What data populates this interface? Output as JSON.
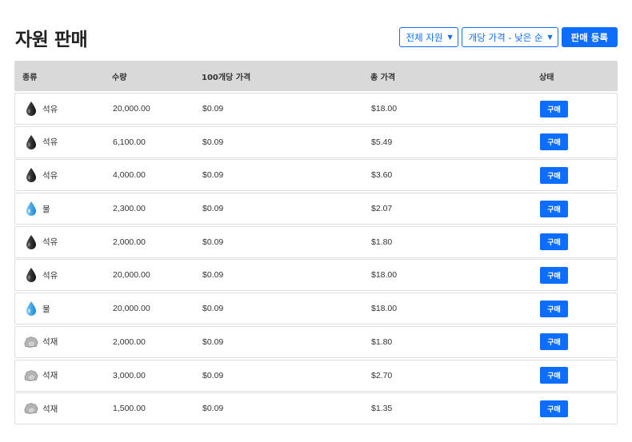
{
  "page": {
    "title": "자원 판매"
  },
  "toolbar": {
    "resource_filter": "전체 자원",
    "sort_filter": "개당 가격 - 낮은 순",
    "register_label": "판매 등록"
  },
  "table": {
    "headers": {
      "type": "종류",
      "quantity": "수량",
      "unit_price": "100개당 가격",
      "total_price": "총 가격",
      "status": "상태"
    },
    "rows": [
      {
        "icon": "oil-drop-icon",
        "name": "석유",
        "quantity": "20,000.00",
        "unit_price": "$0.09",
        "total": "$18.00",
        "action": "구매"
      },
      {
        "icon": "oil-drop-icon",
        "name": "석유",
        "quantity": "6,100.00",
        "unit_price": "$0.09",
        "total": "$5.49",
        "action": "구매"
      },
      {
        "icon": "oil-drop-icon",
        "name": "석유",
        "quantity": "4,000.00",
        "unit_price": "$0.09",
        "total": "$3.60",
        "action": "구매"
      },
      {
        "icon": "water-drop-icon",
        "name": "물",
        "quantity": "2,300.00",
        "unit_price": "$0.09",
        "total": "$2.07",
        "action": "구매"
      },
      {
        "icon": "oil-drop-icon",
        "name": "석유",
        "quantity": "2,000.00",
        "unit_price": "$0.09",
        "total": "$1.80",
        "action": "구매"
      },
      {
        "icon": "oil-drop-icon",
        "name": "석유",
        "quantity": "20,000.00",
        "unit_price": "$0.09",
        "total": "$18.00",
        "action": "구매"
      },
      {
        "icon": "water-drop-icon",
        "name": "물",
        "quantity": "20,000.00",
        "unit_price": "$0.09",
        "total": "$18.00",
        "action": "구매"
      },
      {
        "icon": "stone-icon",
        "name": "석재",
        "quantity": "2,000.00",
        "unit_price": "$0.09",
        "total": "$1.80",
        "action": "구매"
      },
      {
        "icon": "stone-icon",
        "name": "석재",
        "quantity": "3,000.00",
        "unit_price": "$0.09",
        "total": "$2.70",
        "action": "구매"
      },
      {
        "icon": "stone-icon",
        "name": "석재",
        "quantity": "1,500.00",
        "unit_price": "$0.09",
        "total": "$1.35",
        "action": "구매"
      }
    ]
  },
  "colors": {
    "primary": "#0d6efd",
    "header_bg": "#d9d9d9",
    "oil": "#2b2b2b",
    "water": "#2e9be6",
    "stone": "#9a9a9a"
  }
}
